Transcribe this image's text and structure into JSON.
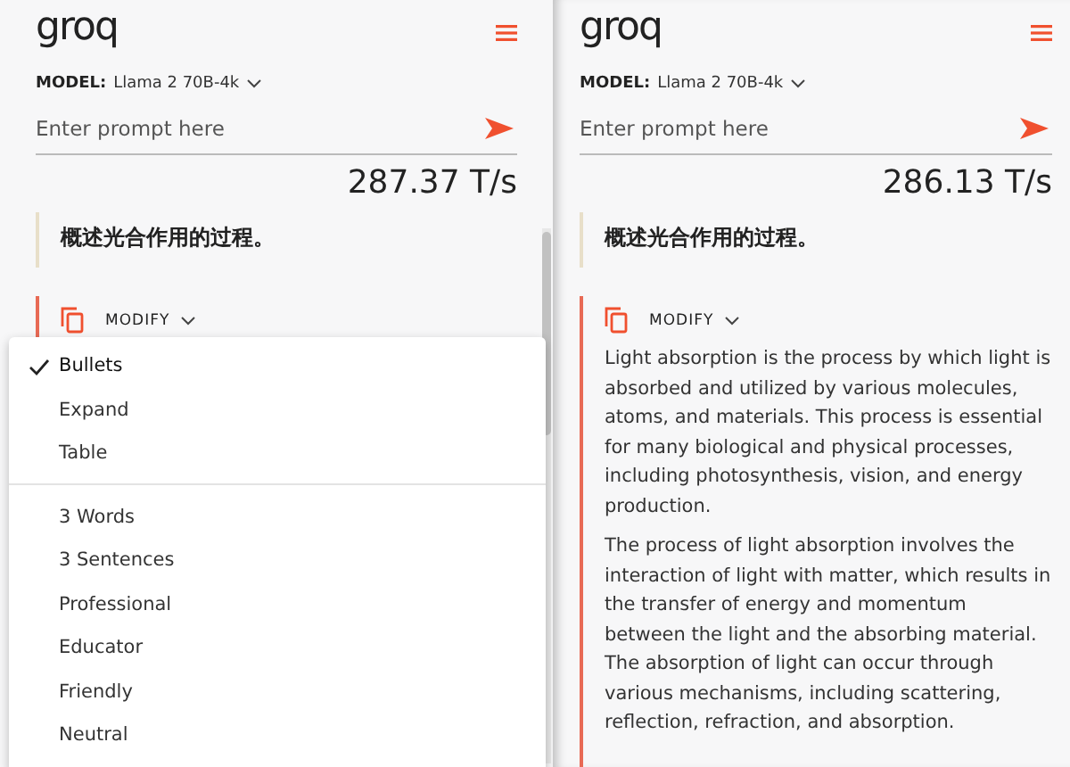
{
  "panels": [
    {
      "logo": "groq",
      "model_label": "MODEL:",
      "model": "Llama 2 70B-4k",
      "prompt_placeholder": "Enter prompt here",
      "speed": "287.37 T/s",
      "prompt": "概述光合作用的过程。",
      "modify_label": "MODIFY",
      "scrollbar": true,
      "menu": {
        "sections": [
          {
            "items": [
              {
                "label": "Bullets",
                "selected": true
              },
              {
                "label": "Expand",
                "selected": false
              },
              {
                "label": "Table",
                "selected": false
              }
            ]
          },
          {
            "items": [
              {
                "label": "3 Words",
                "selected": false
              },
              {
                "label": "3 Sentences",
                "selected": false
              },
              {
                "label": "Professional",
                "selected": false
              },
              {
                "label": "Educator",
                "selected": false
              },
              {
                "label": "Friendly",
                "selected": false
              },
              {
                "label": "Neutral",
                "selected": false
              }
            ]
          }
        ]
      }
    },
    {
      "logo": "groq",
      "model_label": "MODEL:",
      "model": "Llama 2 70B-4k",
      "prompt_placeholder": "Enter prompt here",
      "speed": "286.13 T/s",
      "prompt": "概述光合作用的过程。",
      "modify_label": "MODIFY",
      "scrollbar": false,
      "response": [
        "Light absorption is the process by which light is absorbed and utilized by various molecules, atoms, and materials. This process is essential for many biological and physical processes, including photosynthesis, vision, and energy production.",
        "The process of light absorption involves the interaction of light with matter, which results in the transfer of energy and momentum between the light and the absorbing material. The absorption of light can occur through various mechanisms, including scattering, reflection, refraction, and absorption."
      ]
    }
  ]
}
